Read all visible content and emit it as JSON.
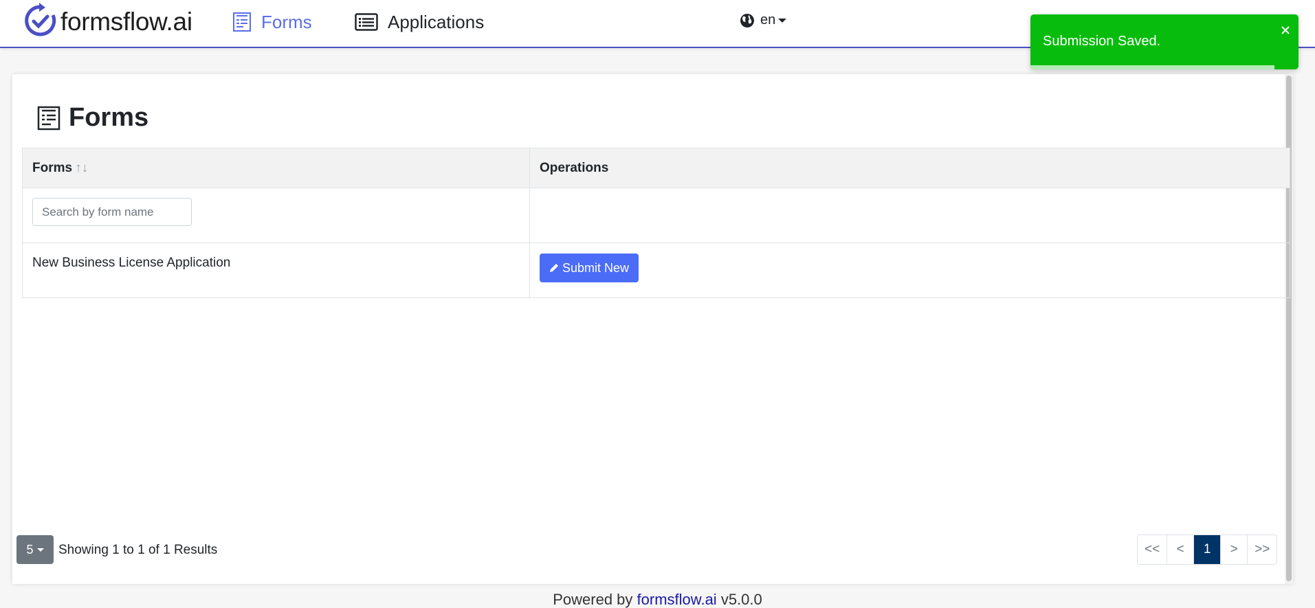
{
  "header": {
    "brand": "formsflow.ai",
    "nav": {
      "forms": "Forms",
      "applications": "Applications"
    },
    "language": "en"
  },
  "toast": {
    "message": "Submission Saved.",
    "progress": 0.91
  },
  "page": {
    "title": "Forms"
  },
  "table": {
    "columns": {
      "forms": "Forms",
      "sort_arrows": "↑↓",
      "operations": "Operations"
    },
    "search_placeholder": "Search by form name",
    "rows": [
      {
        "name": "New Business License Application",
        "action": "Submit New"
      }
    ]
  },
  "pagination": {
    "page_size": "5",
    "results": "Showing 1 to 1 of 1 Results",
    "buttons": {
      "first": "<<",
      "prev": "<",
      "current": "1",
      "next": ">",
      "last": ">>"
    }
  },
  "footer": {
    "prefix": "Powered by",
    "link": "formsflow.ai",
    "version": "v5.0.0"
  },
  "colors": {
    "accent": "#4a6cf7",
    "toast": "#07bc0c",
    "active_page": "#003366"
  }
}
